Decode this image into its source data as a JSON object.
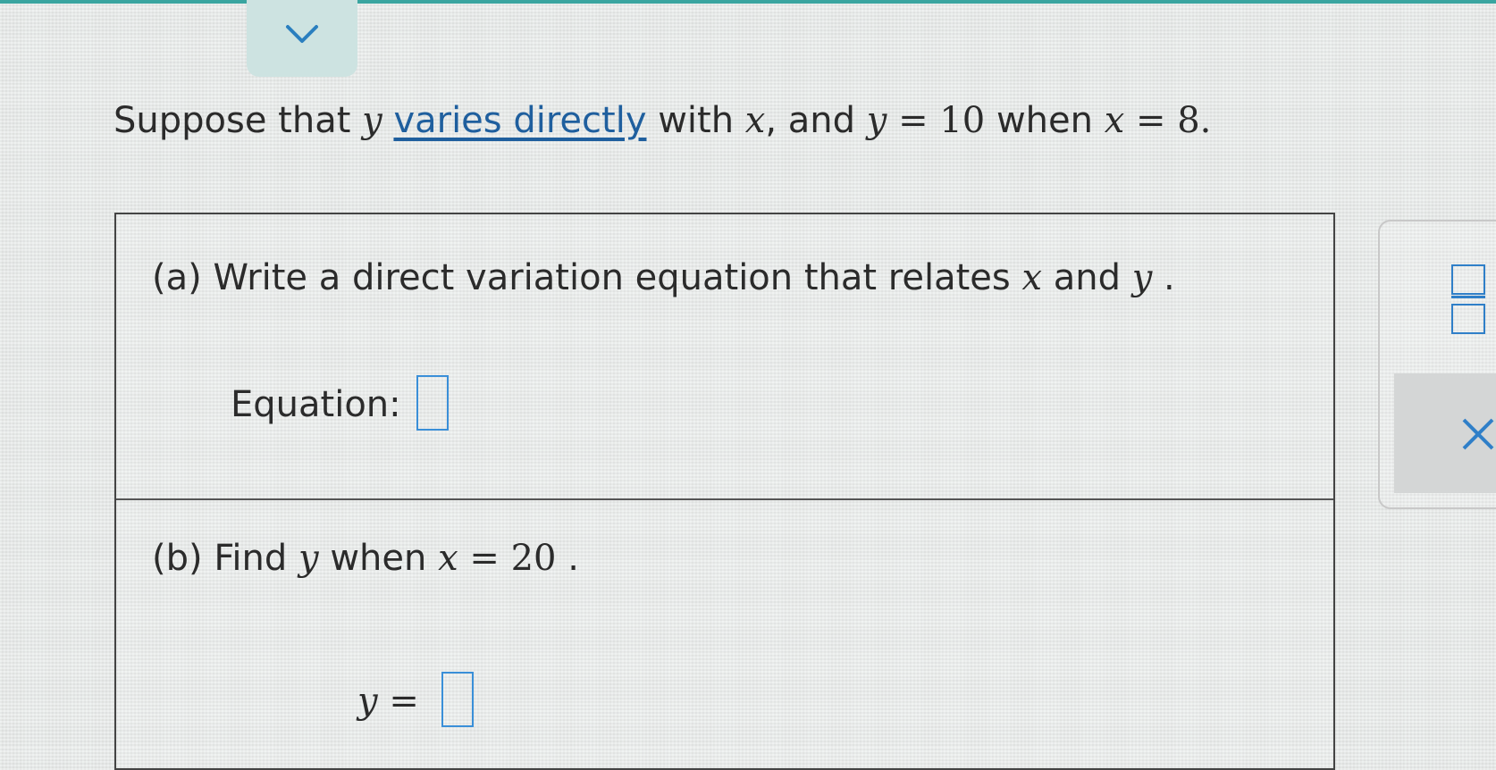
{
  "header": {
    "collapse_icon": "chevron-down-icon",
    "accent_color": "#3aa5a0"
  },
  "problem": {
    "intro": "Suppose that",
    "var_y": "y",
    "link_text": "varies directly",
    "with_text": "with",
    "var_x": "x",
    "comma_and": ", and",
    "equals": "=",
    "given_y_value": "10",
    "when_text": "when",
    "given_x_value": "8",
    "period": "."
  },
  "part_a": {
    "question_prefix": "(a) Write a direct variation equation that relates",
    "var_x": "x",
    "and_text": "and",
    "var_y": "y",
    "period": ".",
    "equation_label": "Equation:",
    "equation_value": ""
  },
  "part_b": {
    "question_prefix": "(b) Find",
    "var_y": "y",
    "when_text": "when",
    "var_x": "x",
    "equals": "=",
    "x_value": "20",
    "period": ".",
    "answer_var": "y",
    "answer_equals": "=",
    "answer_value": ""
  },
  "tools": {
    "fraction_icon": "fraction-icon",
    "clear_icon": "close-icon"
  }
}
